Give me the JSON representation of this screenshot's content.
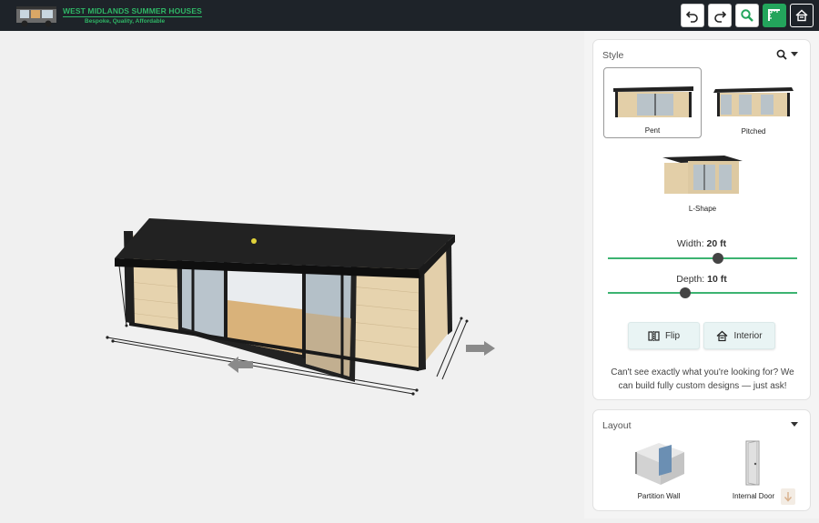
{
  "brand": {
    "title": "WEST MIDLANDS SUMMER HOUSES",
    "tagline": "Bespoke, Quality, Affordable"
  },
  "toolbar": {
    "icons": [
      "undo-icon",
      "redo-icon",
      "zoom-icon",
      "floorplan-icon",
      "home-icon"
    ]
  },
  "style_panel": {
    "heading": "Style",
    "options": [
      {
        "label": "Pent",
        "selected": true
      },
      {
        "label": "Pitched",
        "selected": false
      },
      {
        "label": "L-Shape",
        "selected": false
      }
    ]
  },
  "dimensions": {
    "width": {
      "label": "Width:",
      "value": "20 ft",
      "level": 0.58
    },
    "depth": {
      "label": "Depth:",
      "value": "10 ft",
      "level": 0.41
    }
  },
  "actions": {
    "flip": "Flip",
    "interior": "Interior"
  },
  "custom_message": "Can't see exactly what you're looking for? We can build fully custom designs — just ask!",
  "layout_panel": {
    "heading": "Layout",
    "items": [
      {
        "label": "Partition Wall"
      },
      {
        "label": "Internal Door"
      }
    ]
  },
  "colors": {
    "topbar": "#1e2329",
    "accent": "#23a55c",
    "slider": "#3cb371"
  }
}
